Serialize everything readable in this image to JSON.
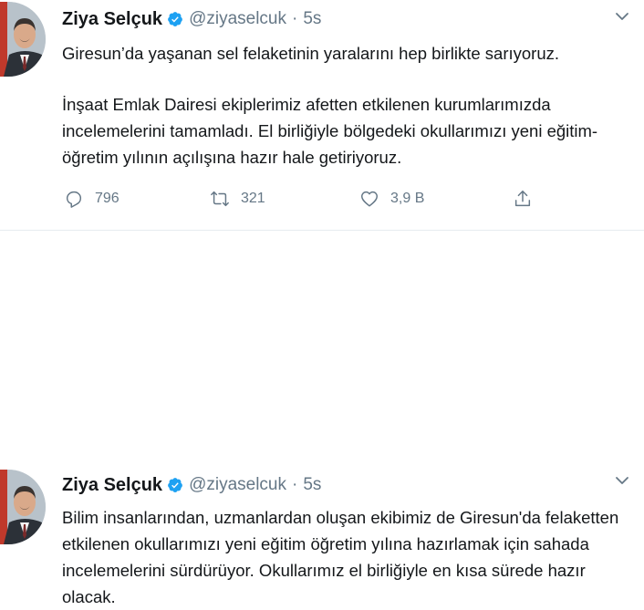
{
  "tweets": [
    {
      "author_name": "Ziya Selçuk",
      "handle": "@ziyaselcuk",
      "separator": "·",
      "time": "5s",
      "paragraphs": [
        "Giresun’da yaşanan sel felaketinin yaralarını hep birlikte sarıyoruz.",
        "İnşaat Emlak Dairesi ekiplerimiz afetten etkilenen kurumlarımızda incelemelerini tamamladı. El birliğiyle bölgedeki okullarımızı yeni eğitim-öğretim yılının açılışına hazır hale getiriyoruz."
      ],
      "stats": {
        "replies": "796",
        "retweets": "321",
        "likes": "3,9 B"
      }
    },
    {
      "author_name": "Ziya Selçuk",
      "handle": "@ziyaselcuk",
      "separator": "·",
      "time": "5s",
      "paragraphs": [
        "Bilim insanlarından, uzmanlardan oluşan ekibimiz de Giresun'da felaketten etkilenen okullarımızı yeni eğitim öğretim yılına hazırlamak için sahada incelemelerini sürdürüyor. Okullarımız el birliğiyle en kısa sürede hazır olacak."
      ]
    }
  ],
  "icons": {
    "verified": "verified-badge-icon",
    "menu": "chevron-down-icon",
    "reply": "reply-icon",
    "retweet": "retweet-icon",
    "like": "heart-icon",
    "share": "share-icon"
  },
  "colors": {
    "accent": "#1da1f2",
    "text": "#14171a",
    "muted": "#657786"
  }
}
